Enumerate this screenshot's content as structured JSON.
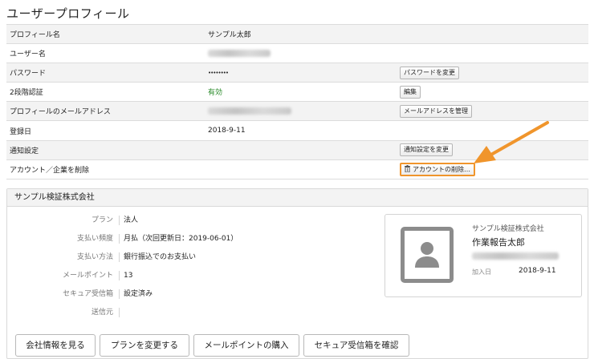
{
  "page": {
    "title": "ユーザープロフィール"
  },
  "profile": {
    "rows": [
      {
        "label": "プロフィール名",
        "value": "サンプル太郎"
      },
      {
        "label": "ユーザー名",
        "value": ""
      },
      {
        "label": "パスワード",
        "value": "••••••••",
        "action": "パスワードを変更"
      },
      {
        "label": "2段階認証",
        "value": "有効",
        "action": "編集"
      },
      {
        "label": "プロフィールのメールアドレス",
        "value": "",
        "action": "メールアドレスを管理"
      },
      {
        "label": "登録日",
        "value": "2018-9-11"
      },
      {
        "label": "通知設定",
        "value": "",
        "action": "通知設定を変更"
      },
      {
        "label": "アカウント／企業を削除",
        "value": "",
        "action": "アカウントの削除…"
      }
    ]
  },
  "company": {
    "name": "サンプル検証株式会社",
    "details": [
      {
        "label": "プラン",
        "value": "法人"
      },
      {
        "label": "支払い頻度",
        "value": "月払（次回更新日：2019-06-01）"
      },
      {
        "label": "支払い方法",
        "value": "銀行振込でのお支払い"
      },
      {
        "label": "メールポイント",
        "value": "13"
      },
      {
        "label": "セキュア受信箱",
        "value": "設定済み"
      },
      {
        "label": "送信元",
        "value": ""
      }
    ],
    "card": {
      "company": "サンプル検証株式会社",
      "name": "作業報告太郎",
      "date_label": "加入日",
      "date": "2018-9-11"
    },
    "actions": {
      "view_company": "会社情報を見る",
      "change_plan": "プランを変更する",
      "buy_points": "メールポイントの購入",
      "check_inbox": "セキュア受信箱を確認"
    }
  },
  "colors": {
    "highlight": "#f0952c",
    "enabled_text": "#2a8a2a",
    "avatar_gray": "#8c8c8c"
  },
  "icons": {
    "delete_button": "trash-icon",
    "avatar": "user-avatar-icon",
    "callout": "arrow-icon"
  }
}
